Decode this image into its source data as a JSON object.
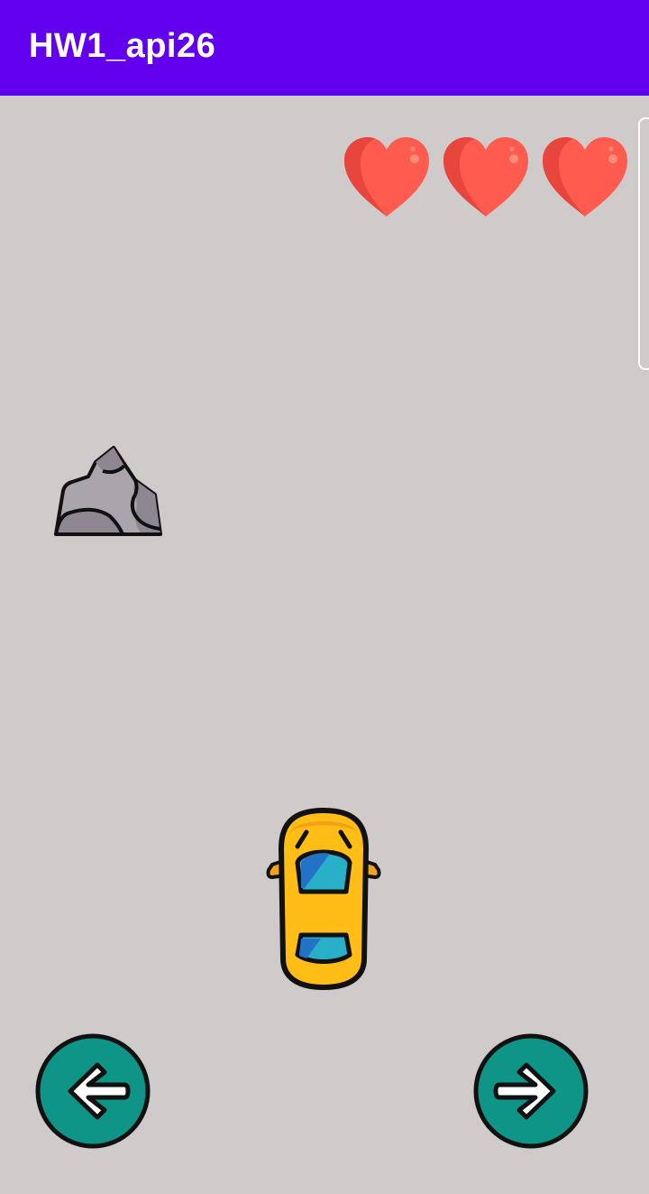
{
  "app_bar": {
    "title": "HW1_api26",
    "color": "#6200ee"
  },
  "game": {
    "background_color": "#d0cbcb",
    "lives": {
      "count": 3,
      "icon": "heart-icon",
      "color": "#f05545"
    },
    "obstacle": {
      "icon": "rock-icon"
    },
    "player": {
      "icon": "car-icon",
      "color": "#ffc107"
    },
    "controls": {
      "left_button_icon": "arrow-left-icon",
      "right_button_icon": "arrow-right-icon",
      "button_color": "#0f9488"
    }
  }
}
